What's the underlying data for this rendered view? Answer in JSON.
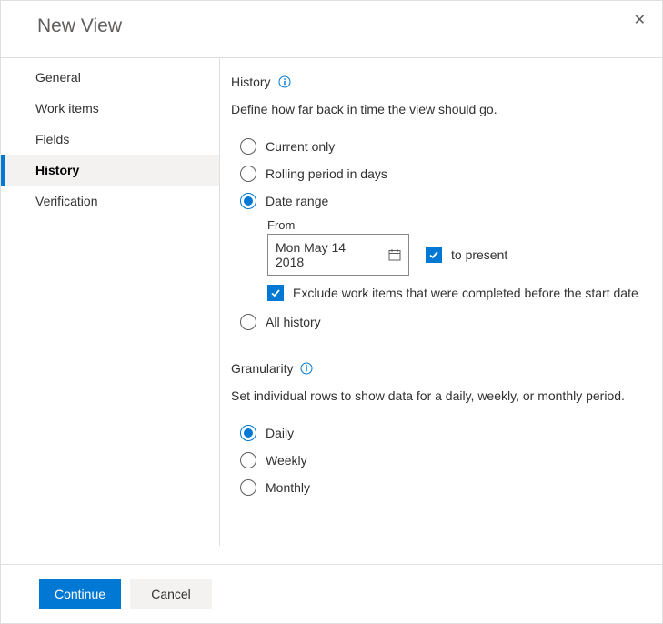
{
  "header": {
    "title": "New View"
  },
  "sidebar": {
    "items": [
      {
        "label": "General"
      },
      {
        "label": "Work items"
      },
      {
        "label": "Fields"
      },
      {
        "label": "History"
      },
      {
        "label": "Verification"
      }
    ],
    "active_index": 3
  },
  "history": {
    "section_label": "History",
    "description": "Define how far back in time the view should go.",
    "options": {
      "current_only": "Current only",
      "rolling": "Rolling period in days",
      "date_range": "Date range",
      "all_history": "All history",
      "selected": "date_range"
    },
    "date_range": {
      "from_label": "From",
      "from_value": "Mon May 14 2018",
      "to_present_checked": true,
      "to_present_label": "to present",
      "exclude_checked": true,
      "exclude_label": "Exclude work items that were completed before the start date"
    }
  },
  "granularity": {
    "section_label": "Granularity",
    "description": "Set individual rows to show data for a daily, weekly, or monthly period.",
    "options": {
      "daily": "Daily",
      "weekly": "Weekly",
      "monthly": "Monthly",
      "selected": "daily"
    }
  },
  "footer": {
    "continue": "Continue",
    "cancel": "Cancel"
  }
}
